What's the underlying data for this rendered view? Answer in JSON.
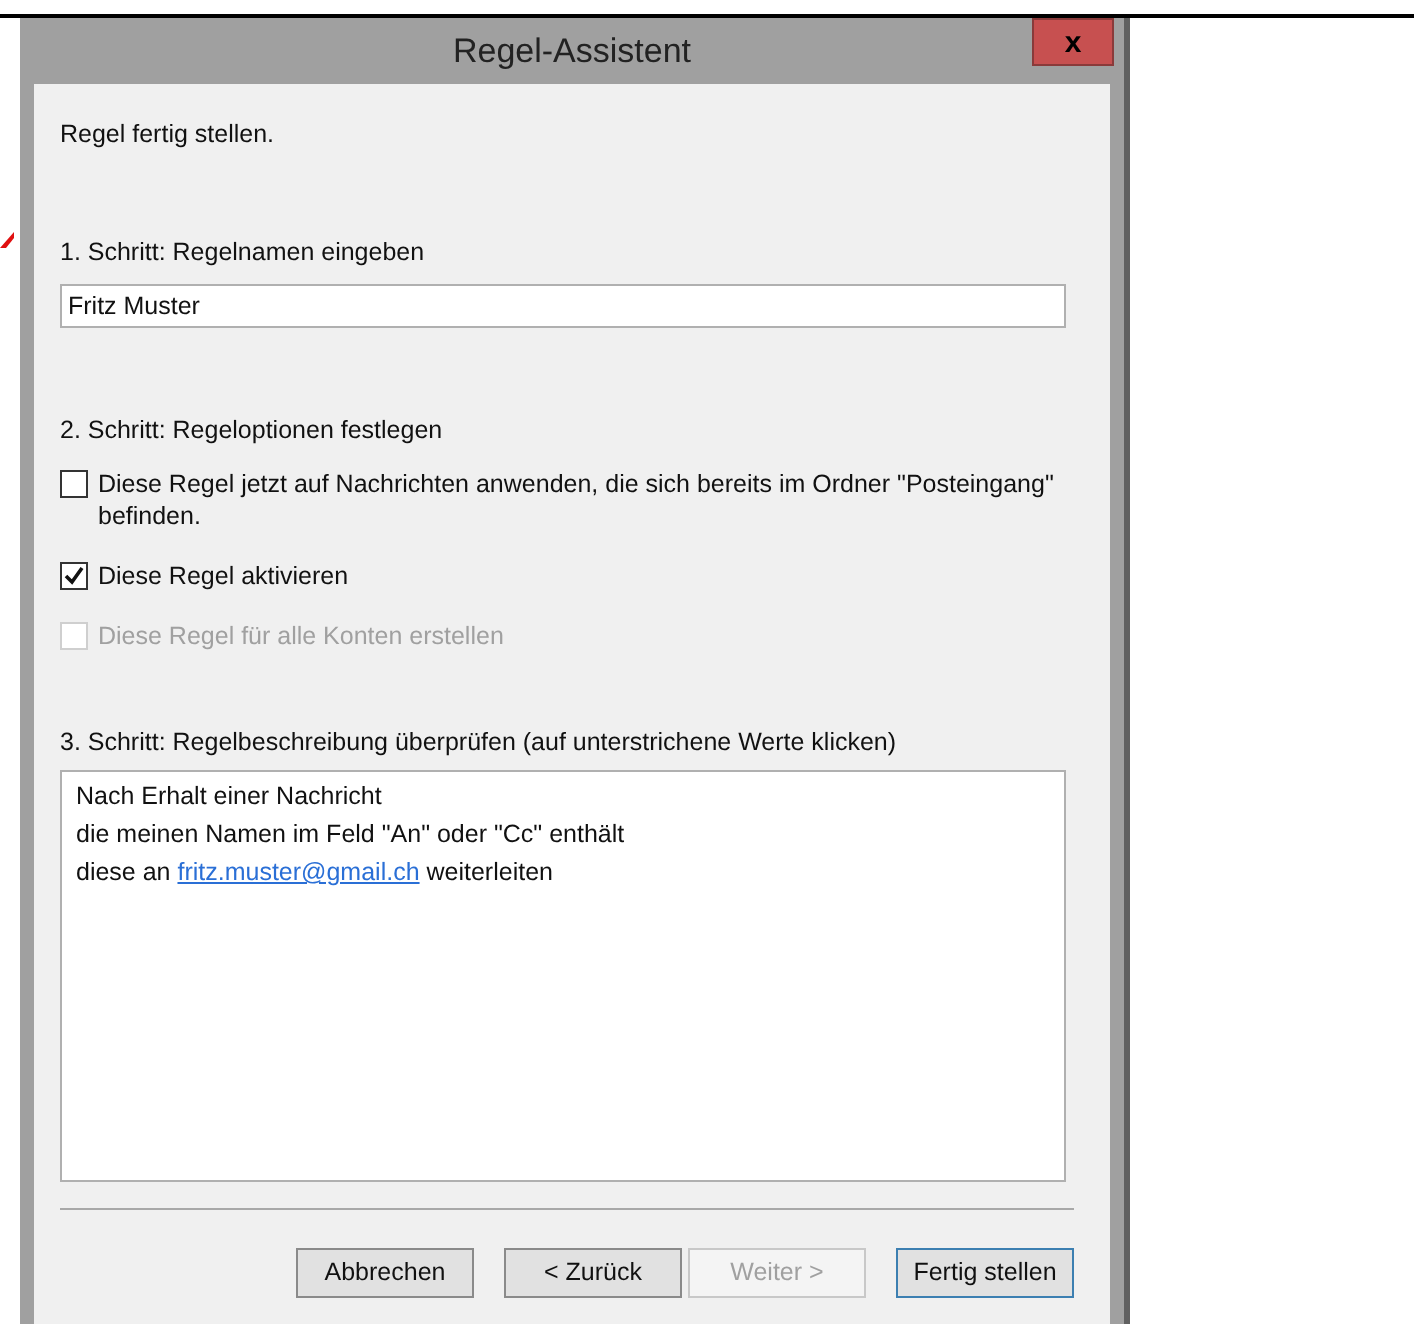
{
  "window": {
    "title": "Regel-Assistent",
    "close": "x"
  },
  "heading": "Regel fertig stellen.",
  "step1": {
    "label": "1. Schritt: Regelnamen eingeben",
    "value": "Fritz Muster"
  },
  "step2": {
    "label": "2. Schritt: Regeloptionen festlegen",
    "options": [
      {
        "label": "Diese Regel jetzt auf Nachrichten anwenden, die sich bereits im Ordner \"Posteingang\" befinden.",
        "checked": false,
        "disabled": false
      },
      {
        "label": "Diese Regel aktivieren",
        "checked": true,
        "disabled": false
      },
      {
        "label": "Diese Regel für alle Konten erstellen",
        "checked": false,
        "disabled": true
      }
    ]
  },
  "step3": {
    "label": "3. Schritt: Regelbeschreibung überprüfen (auf unterstrichene Werte klicken)",
    "lines": [
      {
        "parts": [
          {
            "text": "Nach Erhalt einer Nachricht",
            "link": false
          }
        ]
      },
      {
        "parts": [
          {
            "text": "die meinen Namen im Feld \"An\" oder \"Cc\" enthält",
            "link": false
          }
        ]
      },
      {
        "parts": [
          {
            "text": "diese an ",
            "link": false
          },
          {
            "text": "fritz.muster@gmail.ch",
            "link": true
          },
          {
            "text": " weiterleiten",
            "link": false
          }
        ]
      }
    ]
  },
  "buttons": [
    {
      "label": "Abbrechen",
      "disabled": false,
      "default": false
    },
    {
      "label": "< Zurück",
      "disabled": false,
      "default": false
    },
    {
      "label": "Weiter >",
      "disabled": true,
      "default": false
    },
    {
      "label": "Fertig stellen",
      "disabled": false,
      "default": true
    }
  ]
}
